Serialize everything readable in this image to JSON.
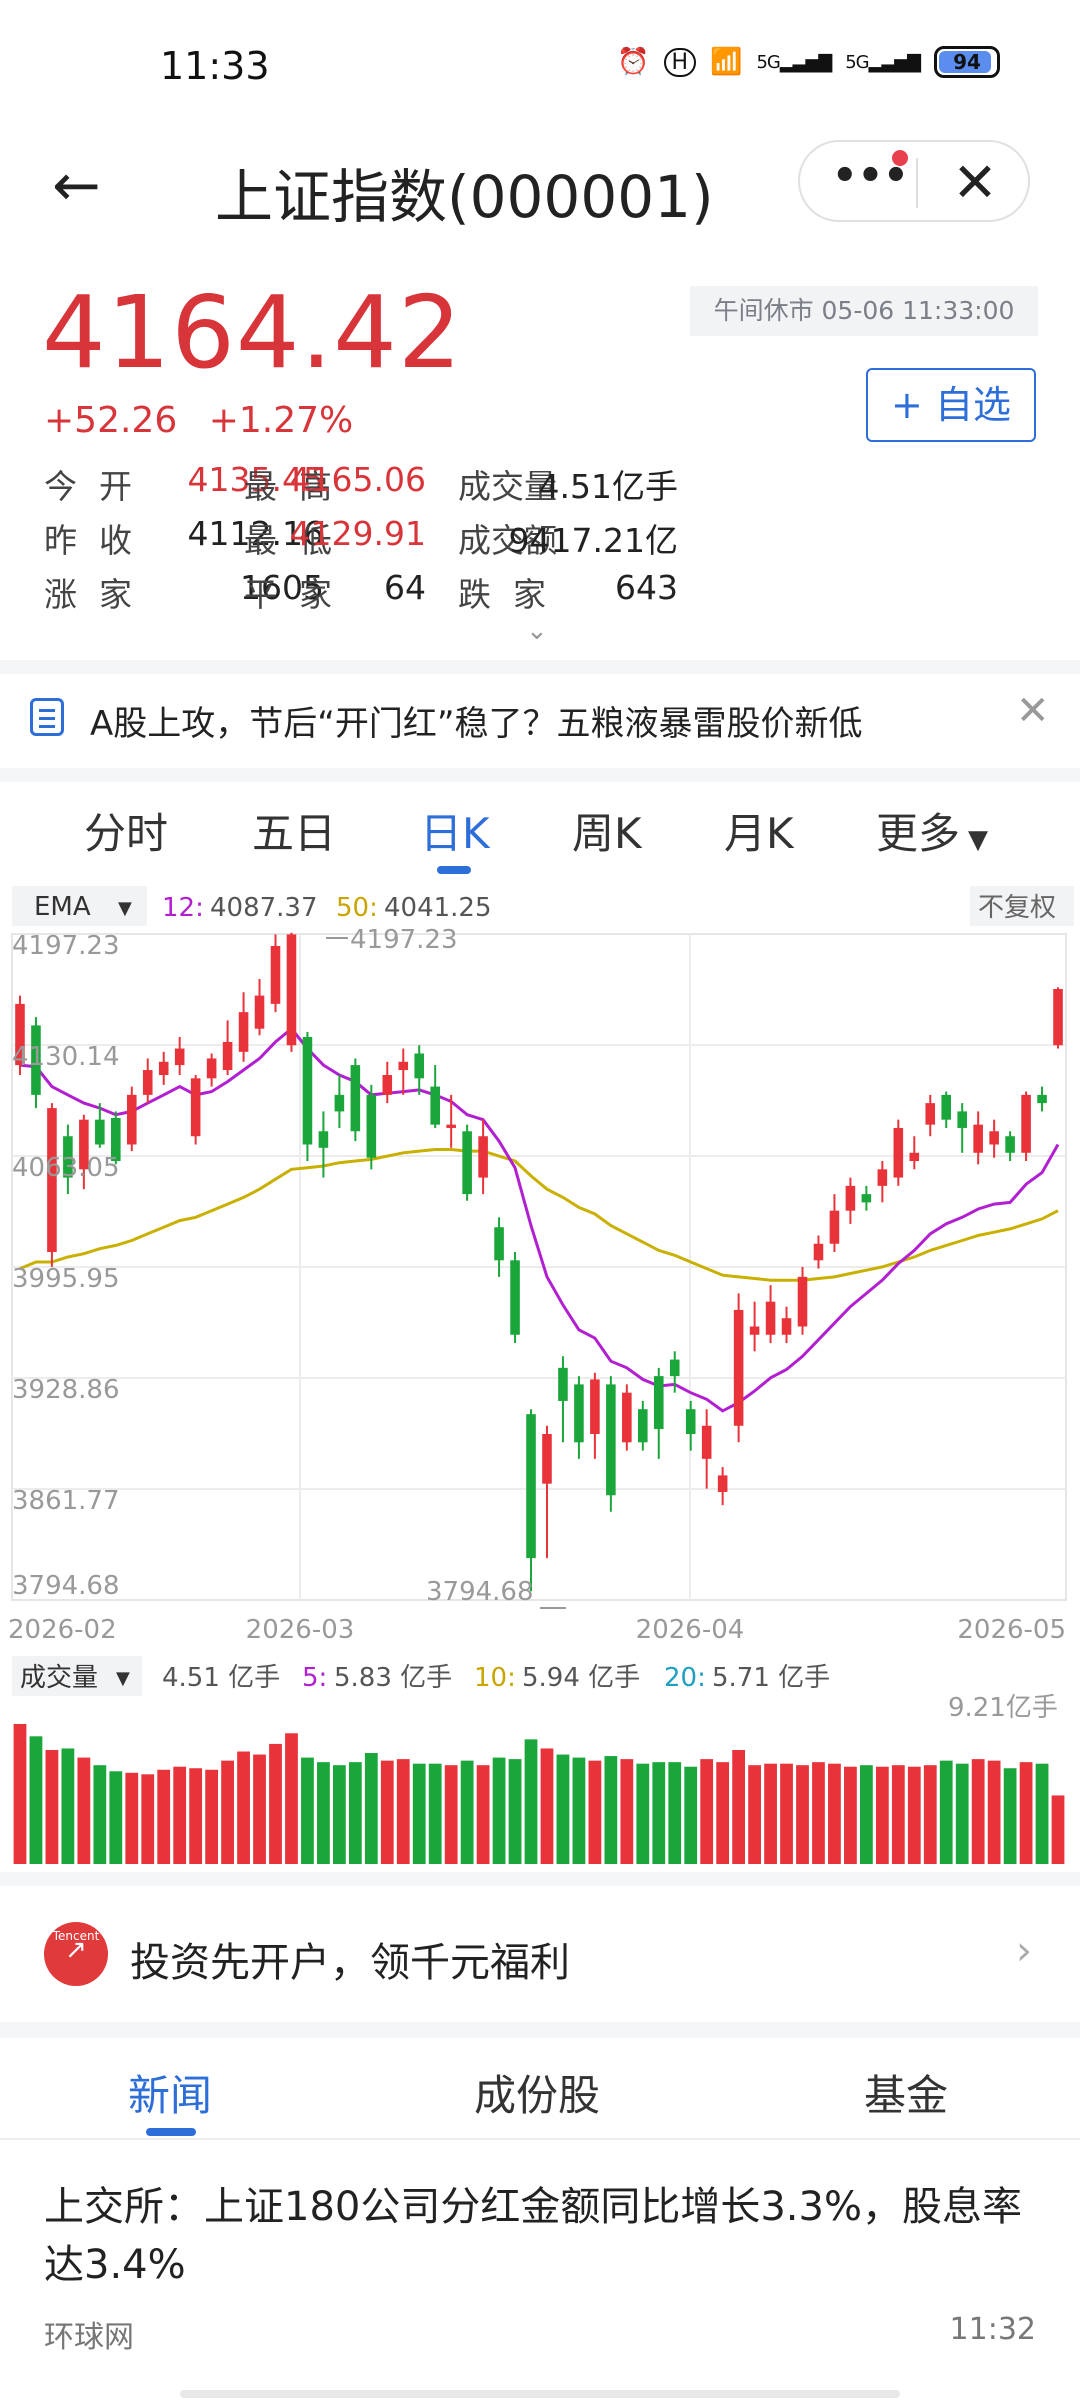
{
  "status_bar": {
    "time": "11:33",
    "icons": [
      "alarm-icon",
      "hd-icon",
      "wifi-icon",
      "5g-signal-icon",
      "5g-signal-icon"
    ],
    "signal_label_1": "5G",
    "signal_label_2": "5G",
    "battery": "94"
  },
  "navbar": {
    "title": "上证指数(000001)",
    "more_label": "•••",
    "close_label": "✕"
  },
  "quote": {
    "price": "4164.42",
    "change": "+52.26",
    "change_pct": "+1.27%",
    "session": "午间休市 05-06 11:33:00",
    "watch_button": "+ 自选",
    "color_up": "#d8353a",
    "stats": [
      {
        "label": "今开",
        "value": "4135.45"
      },
      {
        "label": "最高",
        "value": "4165.06"
      },
      {
        "label": "成交量",
        "value": "4.51亿手"
      },
      {
        "label": "昨收",
        "value": "4112.16"
      },
      {
        "label": "最低",
        "value": "4129.91"
      },
      {
        "label": "成交额",
        "value": "9417.21亿"
      },
      {
        "label": "涨家",
        "value": "1605"
      },
      {
        "label": "平家",
        "value": "64"
      },
      {
        "label": "跌家",
        "value": "643"
      }
    ]
  },
  "news_banner": {
    "text": "A股上攻，节后“开门红”稳了？五粮液暴雷股价新低"
  },
  "chart_tabs": {
    "items": [
      "分时",
      "五日",
      "日K",
      "周K",
      "月K",
      "更多"
    ],
    "active": "日K"
  },
  "indicator_bar": {
    "ema_label": "EMA",
    "ema12_label": "12:",
    "ema12_value": "4087.37",
    "ema50_label": "50:",
    "ema50_value": "4041.25",
    "adjust": "不复权"
  },
  "volume_bar": {
    "label": "成交量",
    "value": "4.51 亿手",
    "ma5_label": "5:",
    "ma5_value": "5.83 亿手",
    "ma10_label": "10:",
    "ma10_value": "5.94 亿手",
    "ma20_label": "20:",
    "ma20_value": "5.71 亿手",
    "max_label": "9.21亿手"
  },
  "chart_data": {
    "type": "candlestick",
    "y_ticks": [
      "4197.23",
      "4130.14",
      "4063.05",
      "3995.95",
      "3928.86",
      "3861.77",
      "3794.68"
    ],
    "x_ticks": [
      "2026-02",
      "2026-03",
      "2026-04",
      "2026-05"
    ],
    "high_label": "4197.23",
    "low_label": "3794.68",
    "ylim": [
      3794.68,
      4197.23
    ],
    "candles": [
      [
        4118,
        4155,
        4112,
        4160
      ],
      [
        4142,
        4100,
        4092,
        4147
      ],
      [
        4005,
        4092,
        3996,
        4095
      ],
      [
        4075,
        4050,
        4040,
        4082
      ],
      [
        4055,
        4085,
        4043,
        4088
      ],
      [
        4085,
        4070,
        4068,
        4095
      ],
      [
        4086,
        4060,
        4058,
        4090
      ],
      [
        4070,
        4100,
        4066,
        4105
      ],
      [
        4100,
        4115,
        4095,
        4122
      ],
      [
        4112,
        4120,
        4106,
        4126
      ],
      [
        4118,
        4128,
        4112,
        4135
      ],
      [
        4075,
        4110,
        4070,
        4112
      ],
      [
        4110,
        4122,
        4105,
        4125
      ],
      [
        4115,
        4132,
        4112,
        4145
      ],
      [
        4126,
        4150,
        4120,
        4162
      ],
      [
        4140,
        4160,
        4136,
        4170
      ],
      [
        4155,
        4190,
        4150,
        4197
      ],
      [
        4130,
        4197,
        4126,
        4198
      ],
      [
        4135,
        4070,
        4060,
        4138
      ],
      [
        4078,
        4068,
        4050,
        4090
      ],
      [
        4100,
        4090,
        4080,
        4112
      ],
      [
        4118,
        4078,
        4072,
        4122
      ],
      [
        4100,
        4062,
        4055,
        4106
      ],
      [
        4100,
        4112,
        4095,
        4120
      ],
      [
        4115,
        4120,
        4100,
        4128
      ],
      [
        4125,
        4110,
        4100,
        4130
      ],
      [
        4105,
        4082,
        4080,
        4118
      ],
      [
        4080,
        4082,
        4068,
        4100
      ],
      [
        4078,
        4040,
        4036,
        4082
      ],
      [
        4050,
        4075,
        4040,
        4085
      ],
      [
        4020,
        4000,
        3990,
        4026
      ],
      [
        4000,
        3955,
        3950,
        4005
      ],
      [
        3907,
        3820,
        3800,
        3910
      ],
      [
        3865,
        3895,
        3820,
        3900
      ],
      [
        3935,
        3915,
        3890,
        3942
      ],
      [
        3925,
        3890,
        3880,
        3930
      ],
      [
        3895,
        3928,
        3880,
        3932
      ],
      [
        3925,
        3858,
        3848,
        3930
      ],
      [
        3890,
        3920,
        3885,
        3925
      ],
      [
        3910,
        3890,
        3885,
        3915
      ],
      [
        3930,
        3898,
        3880,
        3935
      ],
      [
        3940,
        3930,
        3920,
        3945
      ],
      [
        3910,
        3895,
        3885,
        3915
      ],
      [
        3880,
        3900,
        3862,
        3910
      ],
      [
        3860,
        3870,
        3852,
        3875
      ],
      [
        3900,
        3970,
        3890,
        3980
      ],
      [
        3955,
        3960,
        3945,
        3975
      ],
      [
        3955,
        3975,
        3950,
        3985
      ],
      [
        3955,
        3965,
        3950,
        3972
      ],
      [
        3960,
        3990,
        3955,
        3996
      ],
      [
        4000,
        4010,
        3995,
        4015
      ],
      [
        4010,
        4030,
        4005,
        4040
      ],
      [
        4030,
        4045,
        4022,
        4050
      ],
      [
        4040,
        4035,
        4030,
        4045
      ],
      [
        4045,
        4055,
        4035,
        4060
      ],
      [
        4050,
        4080,
        4045,
        4085
      ],
      [
        4060,
        4065,
        4055,
        4075
      ],
      [
        4082,
        4095,
        4075,
        4100
      ],
      [
        4100,
        4085,
        4080,
        4102
      ],
      [
        4090,
        4080,
        4065,
        4095
      ],
      [
        4065,
        4082,
        4058,
        4090
      ],
      [
        4070,
        4078,
        4062,
        4085
      ],
      [
        4075,
        4065,
        4060,
        4078
      ],
      [
        4065,
        4100,
        4060,
        4102
      ],
      [
        4100,
        4095,
        4090,
        4105
      ],
      [
        4130,
        4164,
        4128,
        4165
      ]
    ],
    "ema12": [
      4118,
      4117,
      4105,
      4100,
      4095,
      4092,
      4088,
      4090,
      4095,
      4100,
      4105,
      4100,
      4102,
      4108,
      4115,
      4122,
      4132,
      4140,
      4128,
      4118,
      4112,
      4108,
      4100,
      4101,
      4102,
      4103,
      4100,
      4096,
      4088,
      4085,
      4072,
      4056,
      4021,
      3990,
      3973,
      3958,
      3953,
      3939,
      3935,
      3928,
      3924,
      3925,
      3920,
      3916,
      3909,
      3914,
      3921,
      3929,
      3934,
      3942,
      3952,
      3962,
      3972,
      3980,
      3988,
      3998,
      4006,
      4016,
      4022,
      4026,
      4031,
      4034,
      4035,
      4046,
      4053,
      4070
    ],
    "ema50": [
      3995,
      3999,
      3999,
      4002,
      4004,
      4007,
      4009,
      4012,
      4016,
      4020,
      4024,
      4026,
      4030,
      4034,
      4038,
      4043,
      4049,
      4055,
      4056,
      4057,
      4059,
      4060,
      4061,
      4063,
      4065,
      4066,
      4067,
      4067,
      4066,
      4066,
      4063,
      4060,
      4051,
      4043,
      4038,
      4032,
      4028,
      4021,
      4016,
      4011,
      4006,
      4003,
      3999,
      3995,
      3991,
      3990,
      3989,
      3988,
      3988,
      3988,
      3989,
      3990,
      3992,
      3994,
      3996,
      3999,
      4002,
      4006,
      4009,
      4012,
      4015,
      4017,
      4019,
      4022,
      4025,
      4030
    ],
    "volumes": [
      9.21,
      8.4,
      7.5,
      7.6,
      7.0,
      6.5,
      6.1,
      6.0,
      5.9,
      6.2,
      6.4,
      6.3,
      6.2,
      6.8,
      7.4,
      7.2,
      7.9,
      8.6,
      7.0,
      6.7,
      6.5,
      6.7,
      7.3,
      6.8,
      6.9,
      6.6,
      6.6,
      6.5,
      6.8,
      6.5,
      7.0,
      6.9,
      8.2,
      7.6,
      7.2,
      7.0,
      6.8,
      7.1,
      6.9,
      6.6,
      6.7,
      6.7,
      6.4,
      6.9,
      6.7,
      7.5,
      6.5,
      6.6,
      6.6,
      6.5,
      6.7,
      6.6,
      6.4,
      6.5,
      6.4,
      6.5,
      6.4,
      6.5,
      6.8,
      6.6,
      6.9,
      6.8,
      6.3,
      6.7,
      6.6,
      4.51
    ]
  },
  "promo": {
    "brand": "Tencent",
    "text": "投资先开户，领千元福利",
    "arrow": "›"
  },
  "news_tabs": {
    "items": [
      "新闻",
      "成份股",
      "基金"
    ],
    "active": "新闻"
  },
  "article": {
    "title": "上交所：上证180公司分红金额同比增长3.3%，股息率达3.4%",
    "source": "环球网",
    "time": "11:32"
  }
}
